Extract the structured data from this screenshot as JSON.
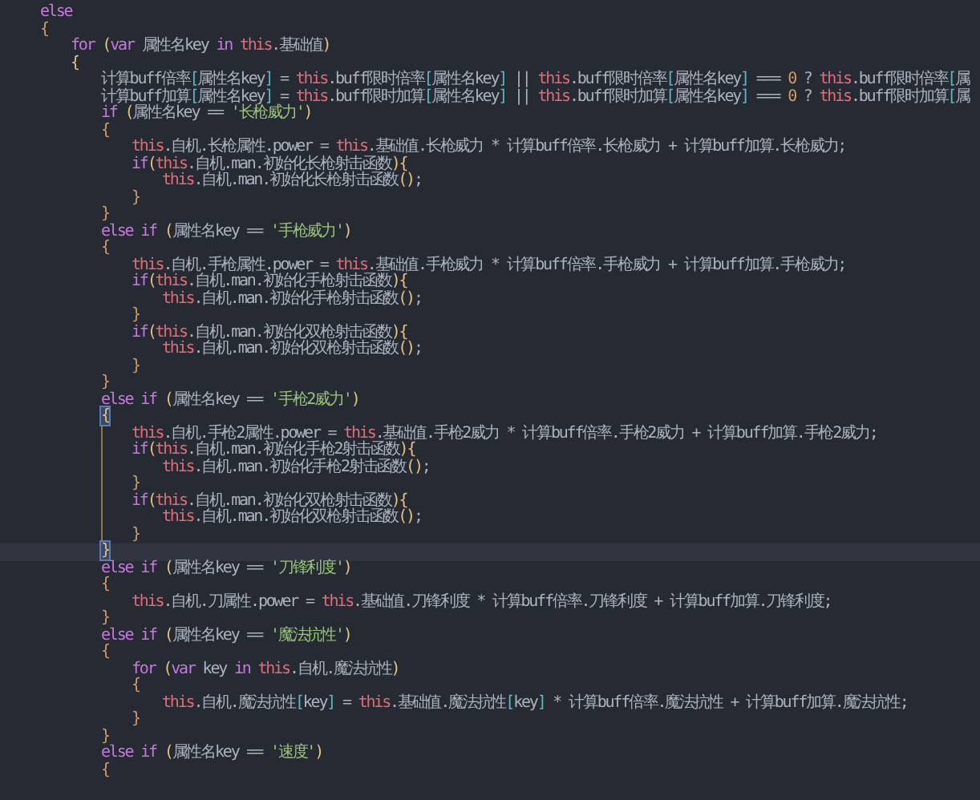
{
  "editor": {
    "lines": [
      {
        "current": false,
        "guide": false,
        "tokens": [
          {
            "kind": "keyword",
            "text": "else"
          }
        ]
      },
      {
        "current": false,
        "guide": false,
        "tokens": [
          {
            "kind": "brace",
            "text": "{"
          }
        ],
        "children": [
          {
            "current": false,
            "guide": false,
            "tokens": [
              {
                "kind": "keyword",
                "text": "for"
              },
              {
                "kind": "paren",
                "text": " ("
              },
              {
                "kind": "keyword",
                "text": "var"
              },
              {
                "kind": "plain",
                "text": " 属性名key "
              },
              {
                "kind": "keyword",
                "text": "in"
              },
              {
                "kind": "self",
                "text": " this"
              },
              {
                "kind": "plain",
                "text": ".基础值"
              },
              {
                "kind": "paren",
                "text": ")"
              }
            ]
          },
          {
            "current": false,
            "guide": false,
            "tokens": [
              {
                "kind": "paren",
                "text": "{"
              }
            ],
            "children": [
              {
                "current": false,
                "guide": false,
                "tokens": [
                  {
                    "kind": "plain",
                    "text": "计算buff倍率"
                  },
                  {
                    "kind": "bracket",
                    "text": "["
                  },
                  {
                    "kind": "plain",
                    "text": "属性名key"
                  },
                  {
                    "kind": "bracket",
                    "text": "]"
                  },
                  {
                    "kind": "plain",
                    "text": " = "
                  },
                  {
                    "kind": "self",
                    "text": "this"
                  },
                  {
                    "kind": "plain",
                    "text": ".buff限时倍率"
                  },
                  {
                    "kind": "bracket",
                    "text": "["
                  },
                  {
                    "kind": "plain",
                    "text": "属性名key"
                  },
                  {
                    "kind": "bracket",
                    "text": "]"
                  },
                  {
                    "kind": "plain",
                    "text": " || "
                  },
                  {
                    "kind": "self",
                    "text": "this"
                  },
                  {
                    "kind": "plain",
                    "text": ".buff限时倍率"
                  },
                  {
                    "kind": "bracket",
                    "text": "["
                  },
                  {
                    "kind": "plain",
                    "text": "属性名key"
                  },
                  {
                    "kind": "bracket",
                    "text": "]"
                  },
                  {
                    "kind": "plain",
                    "text": " === "
                  },
                  {
                    "kind": "number",
                    "text": "0"
                  },
                  {
                    "kind": "plain",
                    "text": " ? "
                  },
                  {
                    "kind": "self",
                    "text": "this"
                  },
                  {
                    "kind": "plain",
                    "text": ".buff限时倍率"
                  },
                  {
                    "kind": "bracket",
                    "text": "["
                  },
                  {
                    "kind": "plain",
                    "text": "属"
                  }
                ]
              },
              {
                "current": false,
                "guide": false,
                "tokens": [
                  {
                    "kind": "plain",
                    "text": "计算buff加算"
                  },
                  {
                    "kind": "bracket",
                    "text": "["
                  },
                  {
                    "kind": "plain",
                    "text": "属性名key"
                  },
                  {
                    "kind": "bracket",
                    "text": "]"
                  },
                  {
                    "kind": "plain",
                    "text": " = "
                  },
                  {
                    "kind": "self",
                    "text": "this"
                  },
                  {
                    "kind": "plain",
                    "text": ".buff限时加算"
                  },
                  {
                    "kind": "bracket",
                    "text": "["
                  },
                  {
                    "kind": "plain",
                    "text": "属性名key"
                  },
                  {
                    "kind": "bracket",
                    "text": "]"
                  },
                  {
                    "kind": "plain",
                    "text": " || "
                  },
                  {
                    "kind": "self",
                    "text": "this"
                  },
                  {
                    "kind": "plain",
                    "text": ".buff限时加算"
                  },
                  {
                    "kind": "bracket",
                    "text": "["
                  },
                  {
                    "kind": "plain",
                    "text": "属性名key"
                  },
                  {
                    "kind": "bracket",
                    "text": "]"
                  },
                  {
                    "kind": "plain",
                    "text": " === "
                  },
                  {
                    "kind": "number",
                    "text": "0"
                  },
                  {
                    "kind": "plain",
                    "text": " ? "
                  },
                  {
                    "kind": "self",
                    "text": "this"
                  },
                  {
                    "kind": "plain",
                    "text": ".buff限时加算"
                  },
                  {
                    "kind": "bracket",
                    "text": "["
                  },
                  {
                    "kind": "plain",
                    "text": "属"
                  }
                ]
              },
              {
                "current": false,
                "guide": false,
                "tokens": [
                  {
                    "kind": "keyword",
                    "text": "if"
                  },
                  {
                    "kind": "paren",
                    "text": " ("
                  },
                  {
                    "kind": "plain",
                    "text": "属性名key == "
                  },
                  {
                    "kind": "string",
                    "text": "'长枪威力'"
                  },
                  {
                    "kind": "paren",
                    "text": ")"
                  }
                ]
              },
              {
                "current": false,
                "guide": false,
                "tokens": [
                  {
                    "kind": "brace",
                    "text": "{"
                  }
                ],
                "children": [
                  {
                    "current": false,
                    "guide": false,
                    "tokens": [
                      {
                        "kind": "self",
                        "text": "this"
                      },
                      {
                        "kind": "plain",
                        "text": ".自机.长枪属性.power = "
                      },
                      {
                        "kind": "self",
                        "text": "this"
                      },
                      {
                        "kind": "plain",
                        "text": ".基础值.长枪威力 * 计算buff倍率.长枪威力 + 计算buff加算.长枪威力;"
                      }
                    ]
                  },
                  {
                    "current": false,
                    "guide": false,
                    "tokens": [
                      {
                        "kind": "keyword",
                        "text": "if"
                      },
                      {
                        "kind": "paren",
                        "text": "("
                      },
                      {
                        "kind": "self",
                        "text": "this"
                      },
                      {
                        "kind": "plain",
                        "text": ".自机.man.初始化长枪射击函数"
                      },
                      {
                        "kind": "paren",
                        "text": "){"
                      }
                    ],
                    "children": [
                      {
                        "current": false,
                        "guide": false,
                        "tokens": [
                          {
                            "kind": "self",
                            "text": "this"
                          },
                          {
                            "kind": "plain",
                            "text": ".自机.man.初始化长枪射击函数"
                          },
                          {
                            "kind": "paren",
                            "text": "()"
                          },
                          {
                            "kind": "plain",
                            "text": ";"
                          }
                        ]
                      }
                    ]
                  },
                  {
                    "current": false,
                    "guide": false,
                    "tokens": [
                      {
                        "kind": "brace",
                        "text": "}"
                      }
                    ]
                  }
                ]
              },
              {
                "current": false,
                "guide": false,
                "tokens": [
                  {
                    "kind": "brace",
                    "text": "}"
                  }
                ]
              },
              {
                "current": false,
                "guide": false,
                "tokens": [
                  {
                    "kind": "keyword",
                    "text": "else if"
                  },
                  {
                    "kind": "paren",
                    "text": " ("
                  },
                  {
                    "kind": "plain",
                    "text": "属性名key == "
                  },
                  {
                    "kind": "string",
                    "text": "'手枪威力'"
                  },
                  {
                    "kind": "paren",
                    "text": ")"
                  }
                ]
              },
              {
                "current": false,
                "guide": false,
                "tokens": [
                  {
                    "kind": "brace",
                    "text": "{"
                  }
                ],
                "children": [
                  {
                    "current": false,
                    "guide": false,
                    "tokens": [
                      {
                        "kind": "self",
                        "text": "this"
                      },
                      {
                        "kind": "plain",
                        "text": ".自机.手枪属性.power = "
                      },
                      {
                        "kind": "self",
                        "text": "this"
                      },
                      {
                        "kind": "plain",
                        "text": ".基础值.手枪威力 * 计算buff倍率.手枪威力 + 计算buff加算.手枪威力;"
                      }
                    ]
                  },
                  {
                    "current": false,
                    "guide": false,
                    "tokens": [
                      {
                        "kind": "keyword",
                        "text": "if"
                      },
                      {
                        "kind": "paren",
                        "text": "("
                      },
                      {
                        "kind": "self",
                        "text": "this"
                      },
                      {
                        "kind": "plain",
                        "text": ".自机.man.初始化手枪射击函数"
                      },
                      {
                        "kind": "paren",
                        "text": "){"
                      }
                    ],
                    "children": [
                      {
                        "current": false,
                        "guide": false,
                        "tokens": [
                          {
                            "kind": "self",
                            "text": "this"
                          },
                          {
                            "kind": "plain",
                            "text": ".自机.man.初始化手枪射击函数"
                          },
                          {
                            "kind": "paren",
                            "text": "()"
                          },
                          {
                            "kind": "plain",
                            "text": ";"
                          }
                        ]
                      }
                    ]
                  },
                  {
                    "current": false,
                    "guide": false,
                    "tokens": [
                      {
                        "kind": "brace",
                        "text": "}"
                      }
                    ]
                  },
                  {
                    "current": false,
                    "guide": false,
                    "tokens": [
                      {
                        "kind": "keyword",
                        "text": "if"
                      },
                      {
                        "kind": "paren",
                        "text": "("
                      },
                      {
                        "kind": "self",
                        "text": "this"
                      },
                      {
                        "kind": "plain",
                        "text": ".自机.man.初始化双枪射击函数"
                      },
                      {
                        "kind": "paren",
                        "text": "){"
                      }
                    ],
                    "children": [
                      {
                        "current": false,
                        "guide": false,
                        "tokens": [
                          {
                            "kind": "self",
                            "text": "this"
                          },
                          {
                            "kind": "plain",
                            "text": ".自机.man.初始化双枪射击函数"
                          },
                          {
                            "kind": "paren",
                            "text": "()"
                          },
                          {
                            "kind": "plain",
                            "text": ";"
                          }
                        ]
                      }
                    ]
                  },
                  {
                    "current": false,
                    "guide": false,
                    "tokens": [
                      {
                        "kind": "brace",
                        "text": "}"
                      }
                    ]
                  }
                ]
              },
              {
                "current": false,
                "guide": false,
                "tokens": [
                  {
                    "kind": "brace",
                    "text": "}"
                  }
                ]
              },
              {
                "current": false,
                "guide": false,
                "tokens": [
                  {
                    "kind": "keyword",
                    "text": "else if"
                  },
                  {
                    "kind": "paren",
                    "text": " ("
                  },
                  {
                    "kind": "plain",
                    "text": "属性名key == "
                  },
                  {
                    "kind": "string",
                    "text": "'手枪2威力'"
                  },
                  {
                    "kind": "paren",
                    "text": ")"
                  }
                ]
              },
              {
                "current": false,
                "guide": false,
                "tokens": [
                  {
                    "kind": "matched",
                    "text": "{"
                  }
                ],
                "children": [
                  {
                    "current": false,
                    "guide": true,
                    "tokens": [
                      {
                        "kind": "self",
                        "text": "this"
                      },
                      {
                        "kind": "plain",
                        "text": ".自机.手枪2属性.power = "
                      },
                      {
                        "kind": "self",
                        "text": "this"
                      },
                      {
                        "kind": "plain",
                        "text": ".基础值.手枪2威力 * 计算buff倍率.手枪2威力 + 计算buff加算.手枪2威力;"
                      }
                    ]
                  },
                  {
                    "current": false,
                    "guide": true,
                    "tokens": [
                      {
                        "kind": "keyword",
                        "text": "if"
                      },
                      {
                        "kind": "paren",
                        "text": "("
                      },
                      {
                        "kind": "self",
                        "text": "this"
                      },
                      {
                        "kind": "plain",
                        "text": ".自机.man.初始化手枪2射击函数"
                      },
                      {
                        "kind": "paren",
                        "text": "){"
                      }
                    ],
                    "children": [
                      {
                        "current": false,
                        "guide": true,
                        "tokens": [
                          {
                            "kind": "self",
                            "text": "this"
                          },
                          {
                            "kind": "plain",
                            "text": ".自机.man.初始化手枪2射击函数"
                          },
                          {
                            "kind": "paren",
                            "text": "()"
                          },
                          {
                            "kind": "plain",
                            "text": ";"
                          }
                        ]
                      }
                    ]
                  },
                  {
                    "current": false,
                    "guide": true,
                    "tokens": [
                      {
                        "kind": "brace",
                        "text": "}"
                      }
                    ]
                  },
                  {
                    "current": false,
                    "guide": true,
                    "tokens": [
                      {
                        "kind": "keyword",
                        "text": "if"
                      },
                      {
                        "kind": "paren",
                        "text": "("
                      },
                      {
                        "kind": "self",
                        "text": "this"
                      },
                      {
                        "kind": "plain",
                        "text": ".自机.man.初始化双枪射击函数"
                      },
                      {
                        "kind": "paren",
                        "text": "){"
                      }
                    ],
                    "children": [
                      {
                        "current": false,
                        "guide": true,
                        "tokens": [
                          {
                            "kind": "self",
                            "text": "this"
                          },
                          {
                            "kind": "plain",
                            "text": ".自机.man.初始化双枪射击函数"
                          },
                          {
                            "kind": "paren",
                            "text": "()"
                          },
                          {
                            "kind": "plain",
                            "text": ";"
                          }
                        ]
                      }
                    ]
                  },
                  {
                    "current": false,
                    "guide": true,
                    "tokens": [
                      {
                        "kind": "brace",
                        "text": "}"
                      }
                    ]
                  }
                ]
              },
              {
                "current": true,
                "guide": false,
                "tokens": [
                  {
                    "kind": "matched",
                    "text": "}"
                  }
                ]
              },
              {
                "current": false,
                "guide": false,
                "tokens": [
                  {
                    "kind": "keyword",
                    "text": "else if"
                  },
                  {
                    "kind": "paren",
                    "text": " ("
                  },
                  {
                    "kind": "plain",
                    "text": "属性名key == "
                  },
                  {
                    "kind": "string",
                    "text": "'刀锋利度'"
                  },
                  {
                    "kind": "paren",
                    "text": ")"
                  }
                ]
              },
              {
                "current": false,
                "guide": false,
                "tokens": [
                  {
                    "kind": "brace",
                    "text": "{"
                  }
                ],
                "children": [
                  {
                    "current": false,
                    "guide": false,
                    "tokens": [
                      {
                        "kind": "self",
                        "text": "this"
                      },
                      {
                        "kind": "plain",
                        "text": ".自机.刀属性.power = "
                      },
                      {
                        "kind": "self",
                        "text": "this"
                      },
                      {
                        "kind": "plain",
                        "text": ".基础值.刀锋利度 * 计算buff倍率.刀锋利度 + 计算buff加算.刀锋利度;"
                      }
                    ]
                  }
                ]
              },
              {
                "current": false,
                "guide": false,
                "tokens": [
                  {
                    "kind": "brace",
                    "text": "}"
                  }
                ]
              },
              {
                "current": false,
                "guide": false,
                "tokens": [
                  {
                    "kind": "keyword",
                    "text": "else if"
                  },
                  {
                    "kind": "paren",
                    "text": " ("
                  },
                  {
                    "kind": "plain",
                    "text": "属性名key == "
                  },
                  {
                    "kind": "string",
                    "text": "'魔法抗性'"
                  },
                  {
                    "kind": "paren",
                    "text": ")"
                  }
                ]
              },
              {
                "current": false,
                "guide": false,
                "tokens": [
                  {
                    "kind": "brace",
                    "text": "{"
                  }
                ],
                "children": [
                  {
                    "current": false,
                    "guide": false,
                    "tokens": [
                      {
                        "kind": "keyword",
                        "text": "for"
                      },
                      {
                        "kind": "paren",
                        "text": " ("
                      },
                      {
                        "kind": "keyword",
                        "text": "var"
                      },
                      {
                        "kind": "plain",
                        "text": " key "
                      },
                      {
                        "kind": "keyword",
                        "text": "in"
                      },
                      {
                        "kind": "self",
                        "text": " this"
                      },
                      {
                        "kind": "plain",
                        "text": ".自机.魔法抗性"
                      },
                      {
                        "kind": "paren",
                        "text": ")"
                      }
                    ]
                  },
                  {
                    "current": false,
                    "guide": false,
                    "tokens": [
                      {
                        "kind": "brace",
                        "text": "{"
                      }
                    ],
                    "children": [
                      {
                        "current": false,
                        "guide": false,
                        "tokens": [
                          {
                            "kind": "self",
                            "text": "this"
                          },
                          {
                            "kind": "plain",
                            "text": ".自机.魔法抗性"
                          },
                          {
                            "kind": "bracket",
                            "text": "["
                          },
                          {
                            "kind": "plain",
                            "text": "key"
                          },
                          {
                            "kind": "bracket",
                            "text": "]"
                          },
                          {
                            "kind": "plain",
                            "text": " = "
                          },
                          {
                            "kind": "self",
                            "text": "this"
                          },
                          {
                            "kind": "plain",
                            "text": ".基础值.魔法抗性"
                          },
                          {
                            "kind": "bracket",
                            "text": "["
                          },
                          {
                            "kind": "plain",
                            "text": "key"
                          },
                          {
                            "kind": "bracket",
                            "text": "]"
                          },
                          {
                            "kind": "plain",
                            "text": " * 计算buff倍率.魔法抗性 + 计算buff加算.魔法抗性;"
                          }
                        ]
                      }
                    ]
                  },
                  {
                    "current": false,
                    "guide": false,
                    "tokens": [
                      {
                        "kind": "brace",
                        "text": "}"
                      }
                    ]
                  }
                ]
              },
              {
                "current": false,
                "guide": false,
                "tokens": [
                  {
                    "kind": "brace",
                    "text": "}"
                  }
                ]
              },
              {
                "current": false,
                "guide": false,
                "tokens": [
                  {
                    "kind": "keyword",
                    "text": "else if"
                  },
                  {
                    "kind": "paren",
                    "text": " ("
                  },
                  {
                    "kind": "plain",
                    "text": "属性名key == "
                  },
                  {
                    "kind": "string",
                    "text": "'速度'"
                  },
                  {
                    "kind": "paren",
                    "text": ")"
                  }
                ]
              },
              {
                "current": false,
                "guide": false,
                "tokens": [
                  {
                    "kind": "brace",
                    "text": "{"
                  }
                ]
              }
            ]
          }
        ]
      }
    ]
  }
}
